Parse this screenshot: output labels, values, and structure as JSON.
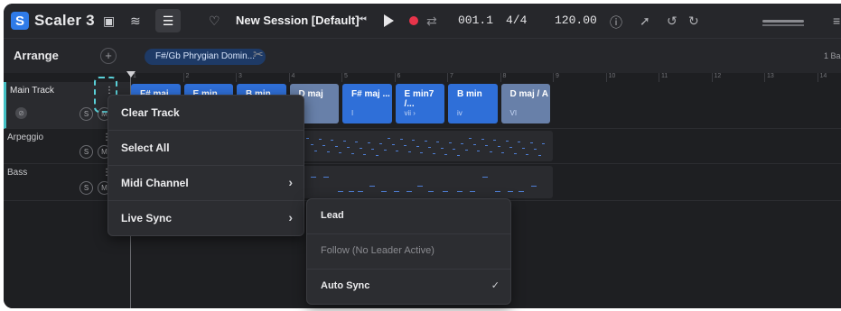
{
  "app": {
    "name": "Scaler 3",
    "logo_glyph": "S"
  },
  "toolbar": {
    "session_title": "New Session [Default]",
    "position": "001.1",
    "time_signature": "4/4",
    "tempo": "120.00"
  },
  "arrange": {
    "label": "Arrange",
    "scale_chip": "F#/Gb Phrygian Domin...",
    "bars_label": "1 Ba"
  },
  "ruler": [
    "1",
    "2",
    "3",
    "4",
    "5",
    "6",
    "7",
    "8",
    "9",
    "10",
    "11",
    "12",
    "13",
    "14"
  ],
  "tracks": [
    {
      "name": "Main Track",
      "s": "S",
      "m": "M"
    },
    {
      "name": "Arpeggio",
      "s": "S",
      "m": "M"
    },
    {
      "name": "Bass",
      "s": "S",
      "m": "M"
    }
  ],
  "chords": [
    {
      "name": "F# maj",
      "degree": ""
    },
    {
      "name": "E min",
      "degree": ""
    },
    {
      "name": "B min",
      "degree": ""
    },
    {
      "name": "D maj",
      "degree": ""
    },
    {
      "name": "F# maj ...",
      "degree": "I"
    },
    {
      "name": "E min7 /...",
      "degree": "vii ›"
    },
    {
      "name": "B min",
      "degree": "iv"
    },
    {
      "name": "D maj / A",
      "degree": "VI"
    }
  ],
  "context_menu": {
    "items": [
      {
        "label": "Clear Track",
        "submenu": false
      },
      {
        "label": "Select All",
        "submenu": false
      },
      {
        "label": "Midi Channel",
        "submenu": true
      },
      {
        "label": "Live Sync",
        "submenu": true
      }
    ]
  },
  "live_sync_menu": {
    "items": [
      {
        "label": "Lead",
        "enabled": true,
        "checked": false
      },
      {
        "label": "Follow (No Leader Active)",
        "enabled": false,
        "checked": false
      },
      {
        "label": "Auto Sync",
        "enabled": true,
        "checked": true
      }
    ]
  },
  "colors": {
    "accent": "#2f6fd8",
    "selected_track_bar": "#43c0c4",
    "record": "#e8344a"
  }
}
